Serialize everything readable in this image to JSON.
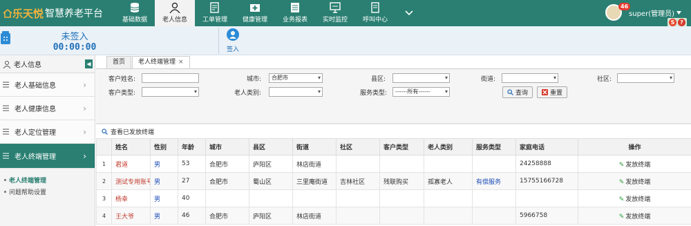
{
  "brand": {
    "logo": "乐天悦",
    "name": "智慧养老平台"
  },
  "nav": [
    {
      "label": "基础数据",
      "icon": "database-icon"
    },
    {
      "label": "老人信息",
      "icon": "user-icon"
    },
    {
      "label": "工单管理",
      "icon": "form-icon"
    },
    {
      "label": "健康管理",
      "icon": "health-icon"
    },
    {
      "label": "业务报表",
      "icon": "report-icon"
    },
    {
      "label": "实时监控",
      "icon": "monitor-icon"
    },
    {
      "label": "呼叫中心",
      "icon": "call-center-icon"
    }
  ],
  "user": {
    "badge": "46",
    "name": "super(管理员)"
  },
  "call": {
    "status": "未签入",
    "timer": "00:00:00",
    "signin_label": "签入"
  },
  "sidebar": {
    "title": "老人信息",
    "items": [
      {
        "label": "老人基础信息"
      },
      {
        "label": "老人健康信息"
      },
      {
        "label": "老人定位管理"
      },
      {
        "label": "老人终端管理"
      }
    ],
    "subitems": [
      {
        "label": "老人终端管理"
      },
      {
        "label": "问题帮助设置"
      }
    ]
  },
  "tabs": [
    {
      "label": "首页"
    },
    {
      "label": "老人终端管理"
    }
  ],
  "filters": {
    "name_label": "客户姓名:",
    "city_label": "城市:",
    "city_value": "合肥市",
    "county_label": "县区:",
    "street_label": "街道:",
    "community_label": "社区:",
    "type_label": "客户类型:",
    "elder_type_label": "老人类别:",
    "service_type_label": "服务类型:",
    "service_type_value": "------所有------",
    "search_btn": "查询",
    "reset_btn": "重置"
  },
  "grid": {
    "toolbar": "查看已发放终端",
    "columns": [
      "姓名",
      "性别",
      "年龄",
      "城市",
      "县区",
      "街道",
      "社区",
      "客户类型",
      "老人类别",
      "服务类型",
      "家庭电话",
      "操作"
    ],
    "action_label": "发放终端",
    "rows": [
      {
        "idx": "1",
        "name": "君道",
        "gender": "男",
        "age": "53",
        "city": "合肥市",
        "county": "庐阳区",
        "street": "林店街道",
        "community": "",
        "ctype": "",
        "etype": "",
        "svc": "",
        "phone": "24258888"
      },
      {
        "idx": "2",
        "name": "测试专用账号",
        "gender": "男",
        "age": "27",
        "city": "合肥市",
        "county": "蜀山区",
        "street": "三里庵街道",
        "community": "吉林社区",
        "ctype": "残联购买",
        "etype": "孤寡老人",
        "svc": "有偿服务",
        "phone": "15755166728"
      },
      {
        "idx": "3",
        "name": "杨幸",
        "gender": "男",
        "age": "40",
        "city": "",
        "county": "",
        "street": "",
        "community": "",
        "ctype": "",
        "etype": "",
        "svc": "",
        "phone": ""
      },
      {
        "idx": "4",
        "name": "王大爷",
        "gender": "男",
        "age": "46",
        "city": "合肥市",
        "county": "庐阳区",
        "street": "林店街道",
        "community": "",
        "ctype": "",
        "etype": "",
        "svc": "",
        "phone": "5966758"
      }
    ]
  }
}
